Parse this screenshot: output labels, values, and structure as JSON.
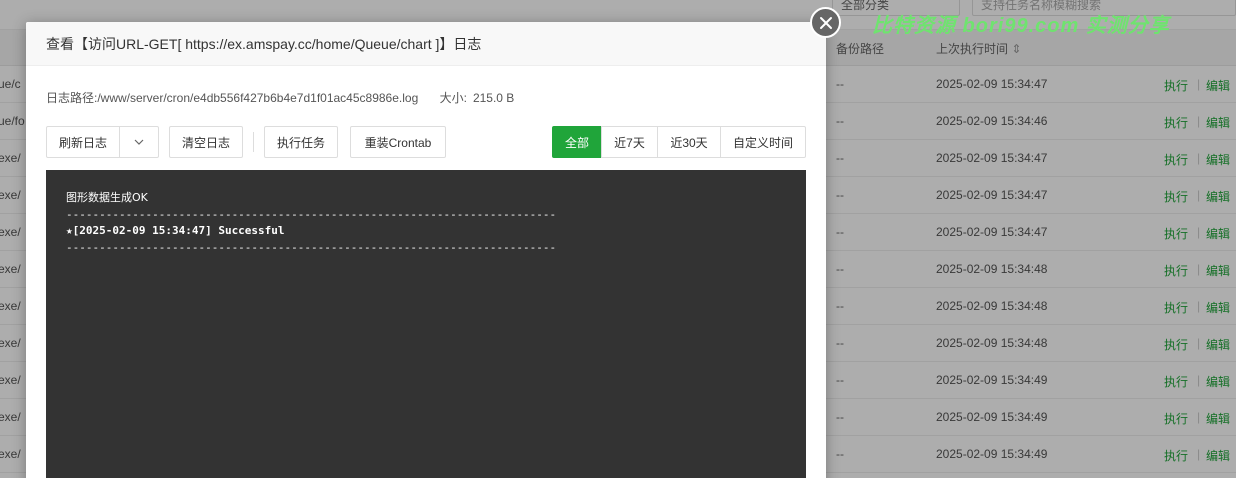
{
  "background": {
    "category_select": "全部分类",
    "search_placeholder": "支持任务名称模糊搜索",
    "columns": {
      "backup_path": "备份路径",
      "last_run": "上次执行时间"
    },
    "rows": [
      {
        "left": "ue/c",
        "backup": "--",
        "time": "2025-02-09 15:34:47",
        "exec": "执行",
        "edit": "编辑"
      },
      {
        "left": "ue/fo",
        "backup": "--",
        "time": "2025-02-09 15:34:46",
        "exec": "执行",
        "edit": "编辑"
      },
      {
        "left": "exe/",
        "backup": "--",
        "time": "2025-02-09 15:34:47",
        "exec": "执行",
        "edit": "编辑"
      },
      {
        "left": "exe/",
        "backup": "--",
        "time": "2025-02-09 15:34:47",
        "exec": "执行",
        "edit": "编辑"
      },
      {
        "left": "exe/",
        "backup": "--",
        "time": "2025-02-09 15:34:47",
        "exec": "执行",
        "edit": "编辑"
      },
      {
        "left": "exe/",
        "backup": "--",
        "time": "2025-02-09 15:34:48",
        "exec": "执行",
        "edit": "编辑"
      },
      {
        "left": "exe/",
        "backup": "--",
        "time": "2025-02-09 15:34:48",
        "exec": "执行",
        "edit": "编辑"
      },
      {
        "left": "exe/",
        "backup": "--",
        "time": "2025-02-09 15:34:48",
        "exec": "执行",
        "edit": "编辑"
      },
      {
        "left": "exe/",
        "backup": "--",
        "time": "2025-02-09 15:34:49",
        "exec": "执行",
        "edit": "编辑"
      },
      {
        "left": "exe/",
        "backup": "--",
        "time": "2025-02-09 15:34:49",
        "exec": "执行",
        "edit": "编辑"
      },
      {
        "left": "exe/",
        "backup": "--",
        "time": "2025-02-09 15:34:49",
        "exec": "执行",
        "edit": "编辑"
      }
    ]
  },
  "watermark": "比特资源 bori99.com 实测分享",
  "modal": {
    "title": "查看【访问URL-GET[ https://ex.amspay.cc/home/Queue/chart ]】日志",
    "log_path_label": "日志路径:",
    "log_path_value": "/www/server/cron/e4db556f427b6b4e7d1f01ac45c8986e.log",
    "size_label": "大小:",
    "size_value": "215.0 B",
    "toolbar": {
      "refresh": "刷新日志",
      "clear": "清空日志",
      "exec_task": "执行任务",
      "reinstall": "重装Crontab"
    },
    "filters": [
      "全部",
      "近7天",
      "近30天",
      "自定义时间"
    ],
    "active_filter": "全部",
    "log_lines": [
      "图形数据生成OK",
      "--------------------------------------------------------------------------",
      "★[2025-02-09 15:34:47] Successful",
      "--------------------------------------------------------------------------"
    ]
  },
  "colors": {
    "accent": "#20a53a",
    "log_bg": "#333333",
    "watermark": "#6fe36f"
  }
}
